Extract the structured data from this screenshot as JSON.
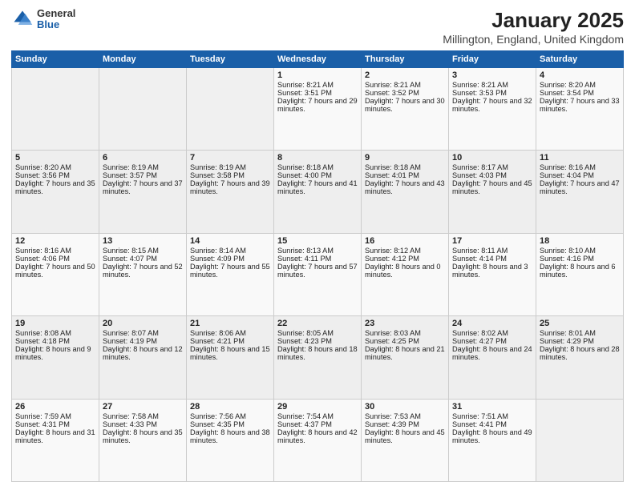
{
  "header": {
    "logo": {
      "general": "General",
      "blue": "Blue"
    },
    "title": "January 2025",
    "subtitle": "Millington, England, United Kingdom"
  },
  "weekdays": [
    "Sunday",
    "Monday",
    "Tuesday",
    "Wednesday",
    "Thursday",
    "Friday",
    "Saturday"
  ],
  "weeks": [
    [
      {
        "day": "",
        "info": ""
      },
      {
        "day": "",
        "info": ""
      },
      {
        "day": "",
        "info": ""
      },
      {
        "day": "1",
        "info": "Sunrise: 8:21 AM\nSunset: 3:51 PM\nDaylight: 7 hours and 29 minutes."
      },
      {
        "day": "2",
        "info": "Sunrise: 8:21 AM\nSunset: 3:52 PM\nDaylight: 7 hours and 30 minutes."
      },
      {
        "day": "3",
        "info": "Sunrise: 8:21 AM\nSunset: 3:53 PM\nDaylight: 7 hours and 32 minutes."
      },
      {
        "day": "4",
        "info": "Sunrise: 8:20 AM\nSunset: 3:54 PM\nDaylight: 7 hours and 33 minutes."
      }
    ],
    [
      {
        "day": "5",
        "info": "Sunrise: 8:20 AM\nSunset: 3:56 PM\nDaylight: 7 hours and 35 minutes."
      },
      {
        "day": "6",
        "info": "Sunrise: 8:19 AM\nSunset: 3:57 PM\nDaylight: 7 hours and 37 minutes."
      },
      {
        "day": "7",
        "info": "Sunrise: 8:19 AM\nSunset: 3:58 PM\nDaylight: 7 hours and 39 minutes."
      },
      {
        "day": "8",
        "info": "Sunrise: 8:18 AM\nSunset: 4:00 PM\nDaylight: 7 hours and 41 minutes."
      },
      {
        "day": "9",
        "info": "Sunrise: 8:18 AM\nSunset: 4:01 PM\nDaylight: 7 hours and 43 minutes."
      },
      {
        "day": "10",
        "info": "Sunrise: 8:17 AM\nSunset: 4:03 PM\nDaylight: 7 hours and 45 minutes."
      },
      {
        "day": "11",
        "info": "Sunrise: 8:16 AM\nSunset: 4:04 PM\nDaylight: 7 hours and 47 minutes."
      }
    ],
    [
      {
        "day": "12",
        "info": "Sunrise: 8:16 AM\nSunset: 4:06 PM\nDaylight: 7 hours and 50 minutes."
      },
      {
        "day": "13",
        "info": "Sunrise: 8:15 AM\nSunset: 4:07 PM\nDaylight: 7 hours and 52 minutes."
      },
      {
        "day": "14",
        "info": "Sunrise: 8:14 AM\nSunset: 4:09 PM\nDaylight: 7 hours and 55 minutes."
      },
      {
        "day": "15",
        "info": "Sunrise: 8:13 AM\nSunset: 4:11 PM\nDaylight: 7 hours and 57 minutes."
      },
      {
        "day": "16",
        "info": "Sunrise: 8:12 AM\nSunset: 4:12 PM\nDaylight: 8 hours and 0 minutes."
      },
      {
        "day": "17",
        "info": "Sunrise: 8:11 AM\nSunset: 4:14 PM\nDaylight: 8 hours and 3 minutes."
      },
      {
        "day": "18",
        "info": "Sunrise: 8:10 AM\nSunset: 4:16 PM\nDaylight: 8 hours and 6 minutes."
      }
    ],
    [
      {
        "day": "19",
        "info": "Sunrise: 8:08 AM\nSunset: 4:18 PM\nDaylight: 8 hours and 9 minutes."
      },
      {
        "day": "20",
        "info": "Sunrise: 8:07 AM\nSunset: 4:19 PM\nDaylight: 8 hours and 12 minutes."
      },
      {
        "day": "21",
        "info": "Sunrise: 8:06 AM\nSunset: 4:21 PM\nDaylight: 8 hours and 15 minutes."
      },
      {
        "day": "22",
        "info": "Sunrise: 8:05 AM\nSunset: 4:23 PM\nDaylight: 8 hours and 18 minutes."
      },
      {
        "day": "23",
        "info": "Sunrise: 8:03 AM\nSunset: 4:25 PM\nDaylight: 8 hours and 21 minutes."
      },
      {
        "day": "24",
        "info": "Sunrise: 8:02 AM\nSunset: 4:27 PM\nDaylight: 8 hours and 24 minutes."
      },
      {
        "day": "25",
        "info": "Sunrise: 8:01 AM\nSunset: 4:29 PM\nDaylight: 8 hours and 28 minutes."
      }
    ],
    [
      {
        "day": "26",
        "info": "Sunrise: 7:59 AM\nSunset: 4:31 PM\nDaylight: 8 hours and 31 minutes."
      },
      {
        "day": "27",
        "info": "Sunrise: 7:58 AM\nSunset: 4:33 PM\nDaylight: 8 hours and 35 minutes."
      },
      {
        "day": "28",
        "info": "Sunrise: 7:56 AM\nSunset: 4:35 PM\nDaylight: 8 hours and 38 minutes."
      },
      {
        "day": "29",
        "info": "Sunrise: 7:54 AM\nSunset: 4:37 PM\nDaylight: 8 hours and 42 minutes."
      },
      {
        "day": "30",
        "info": "Sunrise: 7:53 AM\nSunset: 4:39 PM\nDaylight: 8 hours and 45 minutes."
      },
      {
        "day": "31",
        "info": "Sunrise: 7:51 AM\nSunset: 4:41 PM\nDaylight: 8 hours and 49 minutes."
      },
      {
        "day": "",
        "info": ""
      }
    ]
  ]
}
